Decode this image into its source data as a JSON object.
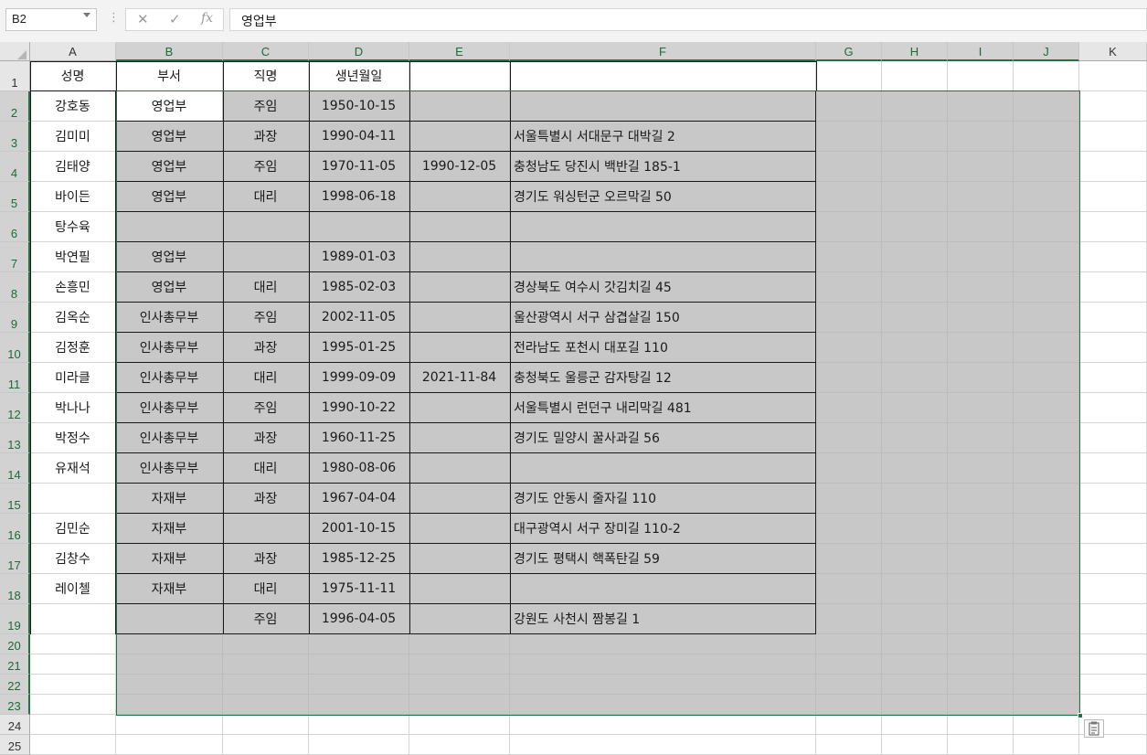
{
  "namebox": "B2",
  "formula_icons": {
    "cancel": "✕",
    "enter": "✓",
    "fx": "fx"
  },
  "formula_value": "영업부",
  "columns": [
    "A",
    "B",
    "C",
    "D",
    "E",
    "F",
    "G",
    "H",
    "I",
    "J",
    "K"
  ],
  "selected_columns": [
    "B",
    "C",
    "D",
    "E",
    "F",
    "G",
    "H",
    "I",
    "J"
  ],
  "rows": [
    1,
    2,
    3,
    4,
    5,
    6,
    7,
    8,
    9,
    10,
    11,
    12,
    13,
    14,
    15,
    16,
    17,
    18,
    19,
    20,
    21,
    22,
    23,
    24,
    25
  ],
  "header": [
    "성명",
    "부서",
    "직명",
    "생년월일",
    "",
    ""
  ],
  "records": [
    [
      "강호동",
      "영업부",
      "주임",
      "1950-10-15",
      "",
      ""
    ],
    [
      "김미미",
      "영업부",
      "과장",
      "1990-04-11",
      "",
      "서울특별시 서대문구 대박길 2"
    ],
    [
      "김태양",
      "영업부",
      "주임",
      "1970-11-05",
      "1990-12-05",
      "충청남도 당진시 백반길 185-1"
    ],
    [
      "바이든",
      "영업부",
      "대리",
      "1998-06-18",
      "",
      "경기도 워싱턴군 오르막길 50"
    ],
    [
      "탕수육",
      "",
      "",
      "",
      "",
      ""
    ],
    [
      "박연필",
      "영업부",
      "",
      "1989-01-03",
      "",
      ""
    ],
    [
      "손흥민",
      "영업부",
      "대리",
      "1985-02-03",
      "",
      "경상북도 여수시 갓김치길 45"
    ],
    [
      "김옥순",
      "인사총무부",
      "주임",
      "2002-11-05",
      "",
      "울산광역시 서구 삼겹살길 150"
    ],
    [
      "김정훈",
      "인사총무부",
      "과장",
      "1995-01-25",
      "",
      "전라남도 포천시 대포길 110"
    ],
    [
      "미라클",
      "인사총무부",
      "대리",
      "1999-09-09",
      "2021-11-84",
      "충청북도 울릉군 감자탕길 12"
    ],
    [
      "박나나",
      "인사총무부",
      "주임",
      "1990-10-22",
      "",
      "서울특별시 런던구 내리막길 481"
    ],
    [
      "박정수",
      "인사총무부",
      "과장",
      "1960-11-25",
      "",
      "경기도 밀양시 꿀사과길 56"
    ],
    [
      "유재석",
      "인사총무부",
      "대리",
      "1980-08-06",
      "",
      ""
    ],
    [
      "",
      "자재부",
      "과장",
      "1967-04-04",
      "",
      "경기도 안동시 줄자길 110"
    ],
    [
      "김민순",
      "자재부",
      "",
      "2001-10-15",
      "",
      "대구광역시 서구 장미길 110-2"
    ],
    [
      "김창수",
      "자재부",
      "과장",
      "1985-12-25",
      "",
      "경기도 평택시 핵폭탄길 59"
    ],
    [
      "레이첼",
      "자재부",
      "대리",
      "1975-11-11",
      "",
      ""
    ],
    [
      "",
      "",
      "주임",
      "1996-04-05",
      "",
      "강원도 사천시 짬봉길 1"
    ]
  ],
  "icons": [
    "dropdown-arrow-icon",
    "cancel-icon",
    "enter-icon",
    "function-icon",
    "paste-options-icon"
  ],
  "colors": {
    "accent": "#217346",
    "selection_fill": "#c8c8c8"
  }
}
